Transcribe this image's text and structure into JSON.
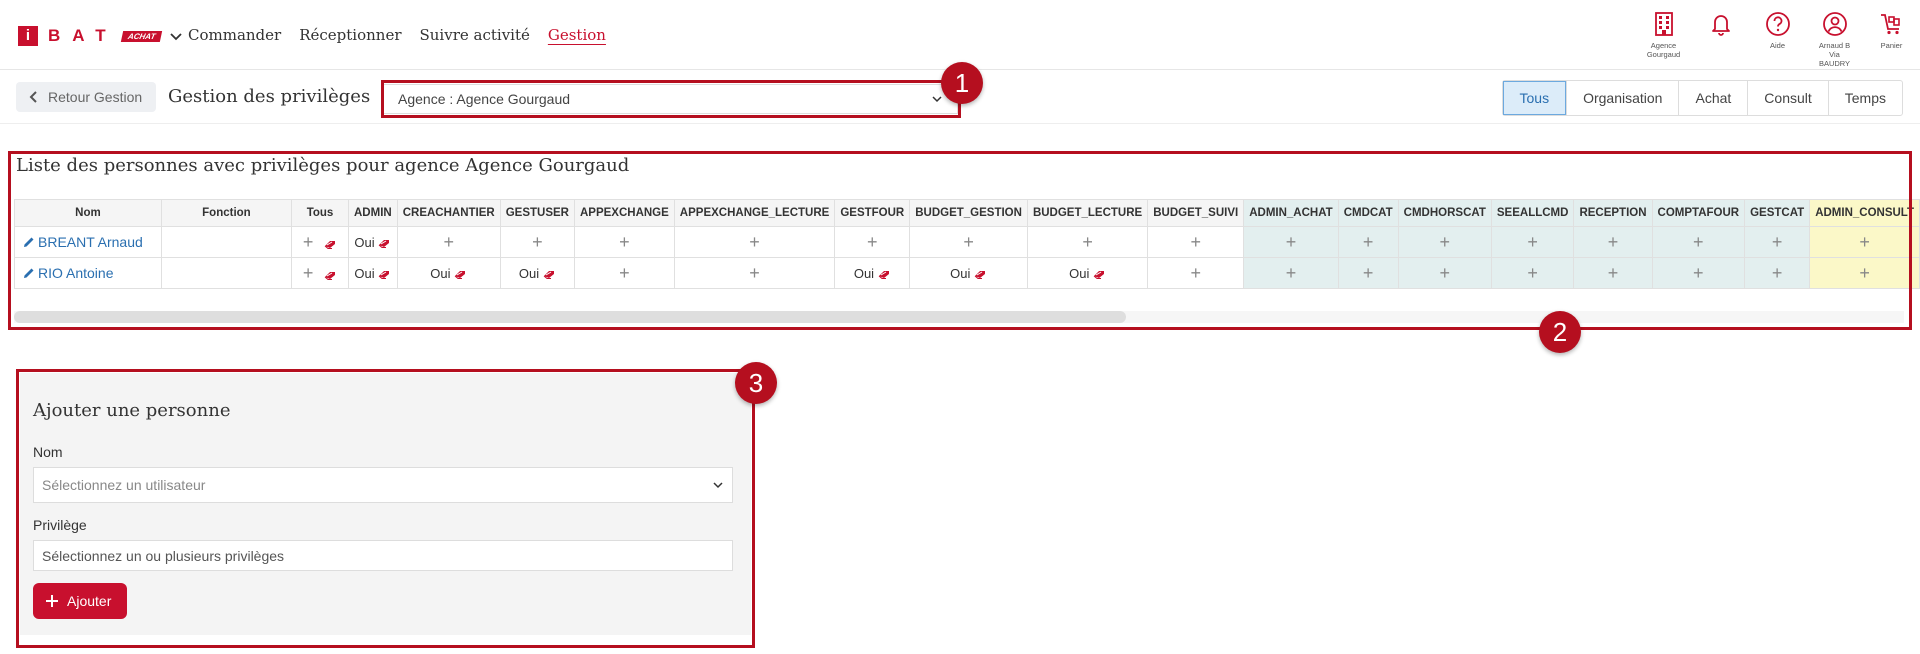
{
  "nav": {
    "logo": {
      "i": "i",
      "bat": "BAT",
      "achat": "ACHAT"
    },
    "items": [
      {
        "label": "Commander"
      },
      {
        "label": "Réceptionner"
      },
      {
        "label": "Suivre activité"
      },
      {
        "label": "Gestion"
      }
    ],
    "icons": [
      {
        "name": "building-icon",
        "label": "Agence Gourgaud"
      },
      {
        "name": "bell-icon",
        "label": ""
      },
      {
        "name": "help-icon",
        "label": "Aide"
      },
      {
        "name": "user-icon",
        "label": "Arnaud B Via BAUDRY"
      },
      {
        "name": "cart-icon",
        "label": "Panier"
      }
    ]
  },
  "subbar": {
    "back_label": "Retour Gestion",
    "title": "Gestion des privilèges",
    "agency_value": "Agence : Agence Gourgaud",
    "tabs": [
      "Tous",
      "Organisation",
      "Achat",
      "Consult",
      "Temps"
    ]
  },
  "annotations": [
    "1",
    "2",
    "3"
  ],
  "list": {
    "title": "Liste des personnes avec privilèges pour agence Agence Gourgaud",
    "columns": [
      "Nom",
      "Fonction",
      "Tous",
      "ADMIN",
      "CREACHANTIER",
      "GESTUSER",
      "APPEXCHANGE",
      "APPEXCHANGE_LECTURE",
      "GESTFOUR",
      "BUDGET_GESTION",
      "BUDGET_LECTURE",
      "BUDGET_SUIVI",
      "ADMIN_ACHAT",
      "CMDCAT",
      "CMDHORSCAT",
      "SEEALLCMD",
      "RECEPTION",
      "COMPTAFOUR",
      "GESTCAT",
      "ADMIN_CONSULT"
    ],
    "oui": "Oui",
    "rows": [
      {
        "name": "BREANT Arnaud",
        "fonction": "",
        "privs": [
          "Oui",
          "",
          "",
          "",
          "",
          "",
          "",
          "",
          "",
          "",
          "",
          "",
          "",
          "",
          "",
          "",
          ""
        ]
      },
      {
        "name": "RIO Antoine",
        "fonction": "",
        "privs": [
          "Oui",
          "Oui",
          "Oui",
          "",
          "",
          "Oui",
          "Oui",
          "Oui",
          "",
          "",
          "",
          "",
          "",
          "",
          "",
          "",
          ""
        ]
      }
    ]
  },
  "add_form": {
    "title": "Ajouter une personne",
    "nom_label": "Nom",
    "nom_placeholder": "Sélectionnez un utilisateur",
    "priv_label": "Privilège",
    "priv_placeholder": "Sélectionnez un ou plusieurs privilèges",
    "add_label": "Ajouter"
  },
  "colors": {
    "brand": "#c8102e",
    "annotation": "#b50f1f",
    "link": "#2a6fb0"
  }
}
